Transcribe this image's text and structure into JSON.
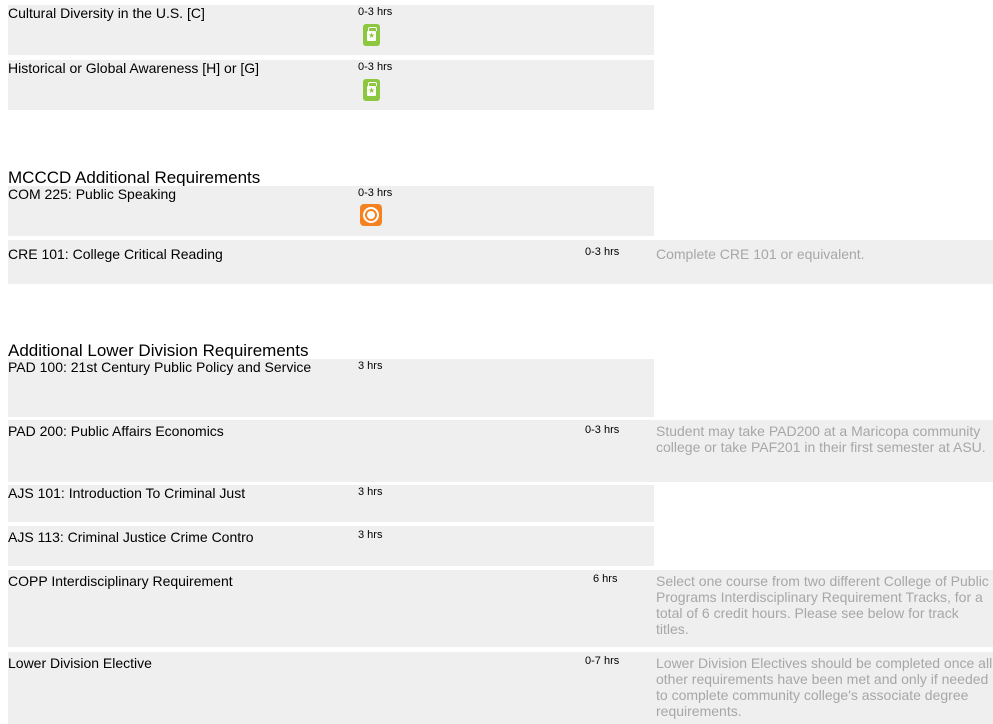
{
  "general_studies": [
    {
      "course": "Cultural Diversity in the U.S. [C]",
      "hours": "0-3 hrs",
      "icon": "general-studies-icon"
    },
    {
      "course": "Historical or Global Awareness [H] or [G]",
      "hours": "0-3 hrs",
      "icon": "general-studies-icon"
    }
  ],
  "mcccd": {
    "title": "MCCCD Additional Requirements",
    "rows": [
      {
        "course": "COM 225: Public Speaking",
        "hours": "0-3 hrs",
        "icon": "critical-course-icon"
      },
      {
        "course": "CRE 101: College Critical Reading",
        "hours": "0-3 hrs",
        "note": "Complete CRE 101 or equivalent."
      }
    ]
  },
  "lower_division": {
    "title": "Additional Lower Division Requirements",
    "rows": [
      {
        "course": "PAD 100: 21st Century Public Policy and Service",
        "hours": "3 hrs"
      },
      {
        "course": "PAD 200: Public Affairs Economics",
        "hours": "0-3 hrs",
        "note": "Student may take PAD200 at a Maricopa community college or take PAF201 in their first semester at ASU."
      },
      {
        "course": "AJS 101: Introduction To Criminal Just",
        "hours": "3 hrs"
      },
      {
        "course": "AJS 113: Criminal Justice Crime Contro",
        "hours": "3 hrs"
      },
      {
        "course": "COPP Interdisciplinary Requirement",
        "hours": "6 hrs",
        "note": "Select one course from two different College of Public Programs Interdisciplinary Requirement Tracks, for a total of 6 credit hours. Please see below for track titles."
      },
      {
        "course": "Lower Division Elective",
        "hours": "0-7 hrs",
        "note": "Lower Division Electives should be completed once all other requirements have been met and only if needed to complete community college's associate degree requirements."
      }
    ]
  },
  "colors": {
    "row_background": "#efefef",
    "note_text": "#a7a7a7",
    "gs_icon": "#8dc63f",
    "critical_icon": "#f58220"
  }
}
